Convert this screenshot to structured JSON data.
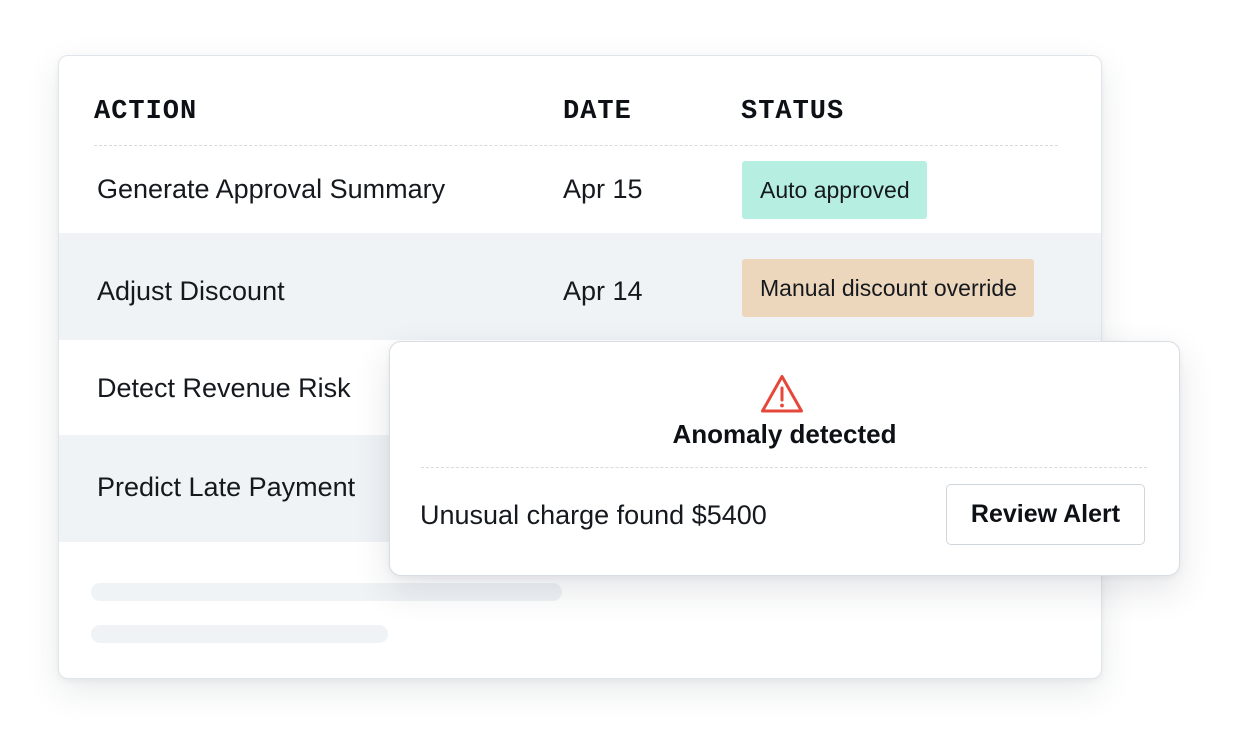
{
  "table": {
    "headers": {
      "action": "ACTION",
      "date": "DATE",
      "status": "STATUS"
    },
    "rows": [
      {
        "action": "Generate Approval Summary",
        "date": "Apr 15",
        "status": "Auto approved",
        "status_color": "#b6efe2"
      },
      {
        "action": "Adjust Discount",
        "date": "Apr 14",
        "status": "Manual discount override",
        "status_color": "#ecd6bc"
      },
      {
        "action": "Detect Revenue Risk"
      },
      {
        "action": "Predict Late Payment"
      }
    ]
  },
  "alert": {
    "icon": "warning-triangle-icon",
    "icon_color": "#e5483a",
    "title": "Anomaly detected",
    "message": "Unusual charge found $5400",
    "button_label": "Review Alert"
  }
}
